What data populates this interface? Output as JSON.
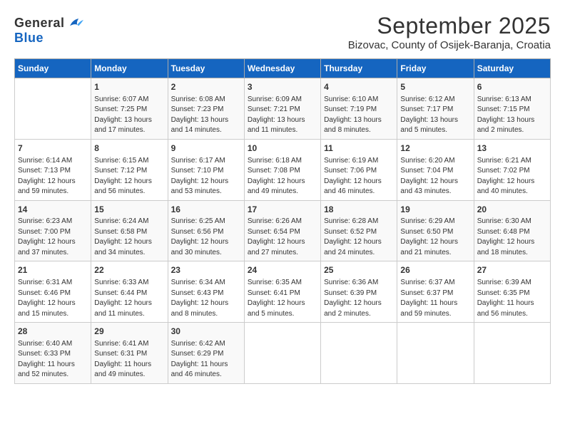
{
  "logo": {
    "general": "General",
    "blue": "Blue"
  },
  "title": "September 2025",
  "subtitle": "Bizovac, County of Osijek-Baranja, Croatia",
  "days_of_week": [
    "Sunday",
    "Monday",
    "Tuesday",
    "Wednesday",
    "Thursday",
    "Friday",
    "Saturday"
  ],
  "weeks": [
    [
      {
        "day": "",
        "info": ""
      },
      {
        "day": "1",
        "info": "Sunrise: 6:07 AM\nSunset: 7:25 PM\nDaylight: 13 hours\nand 17 minutes."
      },
      {
        "day": "2",
        "info": "Sunrise: 6:08 AM\nSunset: 7:23 PM\nDaylight: 13 hours\nand 14 minutes."
      },
      {
        "day": "3",
        "info": "Sunrise: 6:09 AM\nSunset: 7:21 PM\nDaylight: 13 hours\nand 11 minutes."
      },
      {
        "day": "4",
        "info": "Sunrise: 6:10 AM\nSunset: 7:19 PM\nDaylight: 13 hours\nand 8 minutes."
      },
      {
        "day": "5",
        "info": "Sunrise: 6:12 AM\nSunset: 7:17 PM\nDaylight: 13 hours\nand 5 minutes."
      },
      {
        "day": "6",
        "info": "Sunrise: 6:13 AM\nSunset: 7:15 PM\nDaylight: 13 hours\nand 2 minutes."
      }
    ],
    [
      {
        "day": "7",
        "info": "Sunrise: 6:14 AM\nSunset: 7:13 PM\nDaylight: 12 hours\nand 59 minutes."
      },
      {
        "day": "8",
        "info": "Sunrise: 6:15 AM\nSunset: 7:12 PM\nDaylight: 12 hours\nand 56 minutes."
      },
      {
        "day": "9",
        "info": "Sunrise: 6:17 AM\nSunset: 7:10 PM\nDaylight: 12 hours\nand 53 minutes."
      },
      {
        "day": "10",
        "info": "Sunrise: 6:18 AM\nSunset: 7:08 PM\nDaylight: 12 hours\nand 49 minutes."
      },
      {
        "day": "11",
        "info": "Sunrise: 6:19 AM\nSunset: 7:06 PM\nDaylight: 12 hours\nand 46 minutes."
      },
      {
        "day": "12",
        "info": "Sunrise: 6:20 AM\nSunset: 7:04 PM\nDaylight: 12 hours\nand 43 minutes."
      },
      {
        "day": "13",
        "info": "Sunrise: 6:21 AM\nSunset: 7:02 PM\nDaylight: 12 hours\nand 40 minutes."
      }
    ],
    [
      {
        "day": "14",
        "info": "Sunrise: 6:23 AM\nSunset: 7:00 PM\nDaylight: 12 hours\nand 37 minutes."
      },
      {
        "day": "15",
        "info": "Sunrise: 6:24 AM\nSunset: 6:58 PM\nDaylight: 12 hours\nand 34 minutes."
      },
      {
        "day": "16",
        "info": "Sunrise: 6:25 AM\nSunset: 6:56 PM\nDaylight: 12 hours\nand 30 minutes."
      },
      {
        "day": "17",
        "info": "Sunrise: 6:26 AM\nSunset: 6:54 PM\nDaylight: 12 hours\nand 27 minutes."
      },
      {
        "day": "18",
        "info": "Sunrise: 6:28 AM\nSunset: 6:52 PM\nDaylight: 12 hours\nand 24 minutes."
      },
      {
        "day": "19",
        "info": "Sunrise: 6:29 AM\nSunset: 6:50 PM\nDaylight: 12 hours\nand 21 minutes."
      },
      {
        "day": "20",
        "info": "Sunrise: 6:30 AM\nSunset: 6:48 PM\nDaylight: 12 hours\nand 18 minutes."
      }
    ],
    [
      {
        "day": "21",
        "info": "Sunrise: 6:31 AM\nSunset: 6:46 PM\nDaylight: 12 hours\nand 15 minutes."
      },
      {
        "day": "22",
        "info": "Sunrise: 6:33 AM\nSunset: 6:44 PM\nDaylight: 12 hours\nand 11 minutes."
      },
      {
        "day": "23",
        "info": "Sunrise: 6:34 AM\nSunset: 6:43 PM\nDaylight: 12 hours\nand 8 minutes."
      },
      {
        "day": "24",
        "info": "Sunrise: 6:35 AM\nSunset: 6:41 PM\nDaylight: 12 hours\nand 5 minutes."
      },
      {
        "day": "25",
        "info": "Sunrise: 6:36 AM\nSunset: 6:39 PM\nDaylight: 12 hours\nand 2 minutes."
      },
      {
        "day": "26",
        "info": "Sunrise: 6:37 AM\nSunset: 6:37 PM\nDaylight: 11 hours\nand 59 minutes."
      },
      {
        "day": "27",
        "info": "Sunrise: 6:39 AM\nSunset: 6:35 PM\nDaylight: 11 hours\nand 56 minutes."
      }
    ],
    [
      {
        "day": "28",
        "info": "Sunrise: 6:40 AM\nSunset: 6:33 PM\nDaylight: 11 hours\nand 52 minutes."
      },
      {
        "day": "29",
        "info": "Sunrise: 6:41 AM\nSunset: 6:31 PM\nDaylight: 11 hours\nand 49 minutes."
      },
      {
        "day": "30",
        "info": "Sunrise: 6:42 AM\nSunset: 6:29 PM\nDaylight: 11 hours\nand 46 minutes."
      },
      {
        "day": "",
        "info": ""
      },
      {
        "day": "",
        "info": ""
      },
      {
        "day": "",
        "info": ""
      },
      {
        "day": "",
        "info": ""
      }
    ]
  ]
}
